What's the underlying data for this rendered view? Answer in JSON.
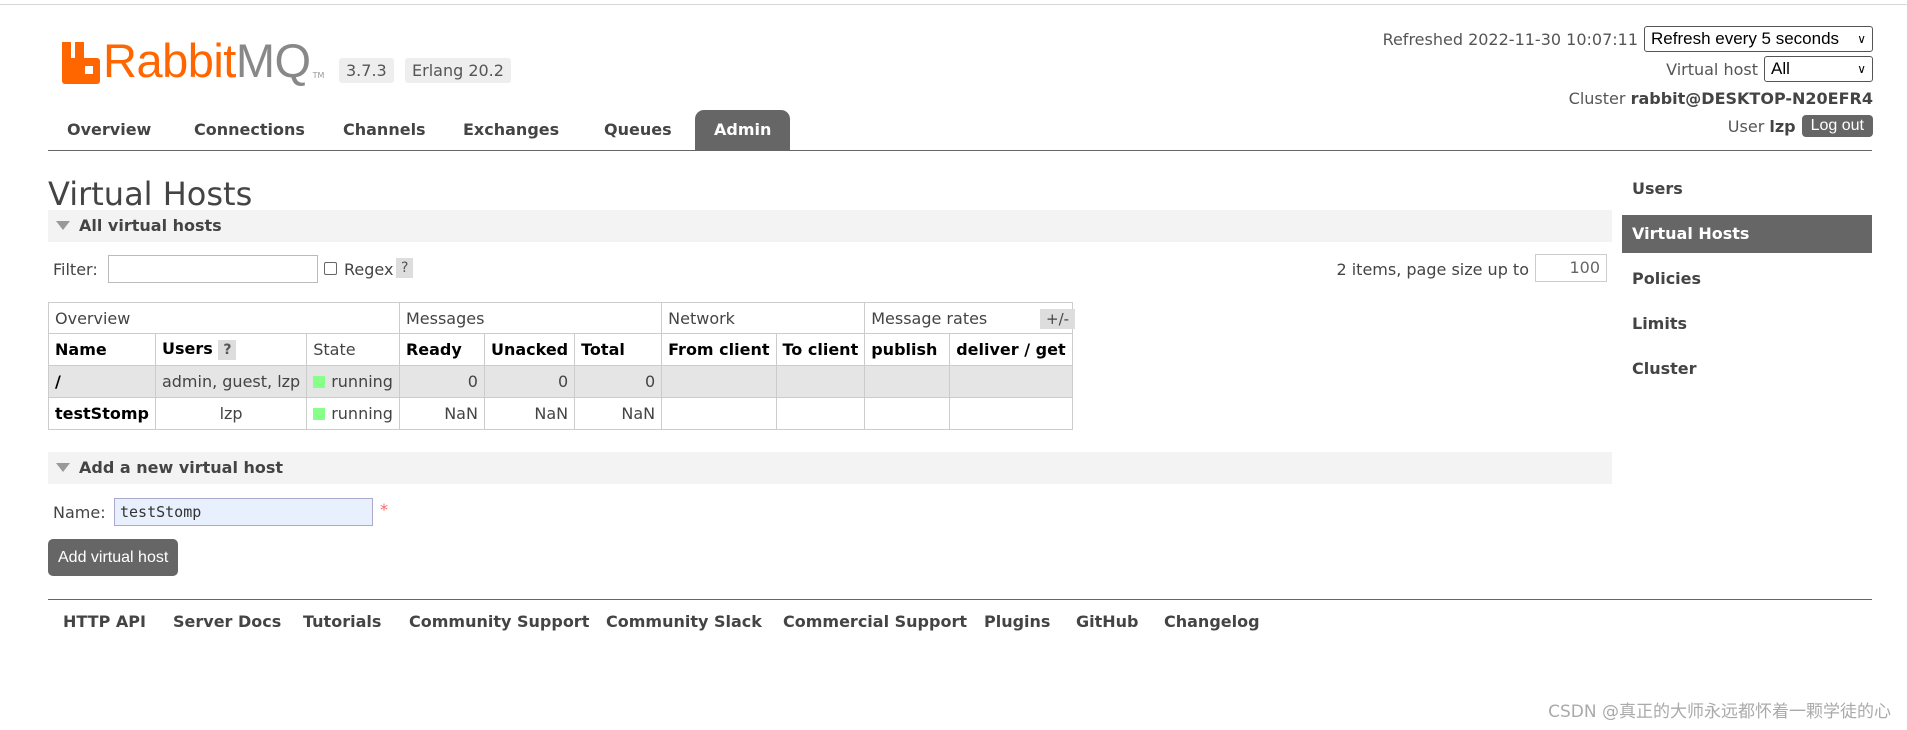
{
  "app": {
    "brand_rabbit": "Rabbit",
    "brand_mq": "MQ",
    "tm": "TM",
    "version": "3.7.3",
    "erlang": "Erlang 20.2"
  },
  "header": {
    "refreshed_label": "Refreshed 2022-11-30 10:07:11",
    "refresh_select": "Refresh every 5 seconds",
    "vhost_label": "Virtual host",
    "vhost_select": "All",
    "cluster_label": "Cluster",
    "cluster_value": "rabbit@DESKTOP-N20EFR4",
    "user_label": "User",
    "user_value": "lzp",
    "logout": "Log out"
  },
  "nav": [
    "Overview",
    "Connections",
    "Channels",
    "Exchanges",
    "Queues",
    "Admin"
  ],
  "page": {
    "title": "Virtual Hosts",
    "section_all": "All virtual hosts",
    "filter_label": "Filter:",
    "regex_label": "Regex",
    "help": "?",
    "items_label": "2 items, page size up to",
    "page_size": "100",
    "toggle_columns": "+/-"
  },
  "table": {
    "groups": [
      "Overview",
      "Messages",
      "Network",
      "Message rates"
    ],
    "columns": [
      "Name",
      "Users",
      "State",
      "Ready",
      "Unacked",
      "Total",
      "From client",
      "To client",
      "publish",
      "deliver / get"
    ],
    "rows": [
      {
        "name": "/",
        "users": "admin, guest, lzp",
        "state": "running",
        "ready": "0",
        "unacked": "0",
        "total": "0"
      },
      {
        "name": "testStomp",
        "users": "lzp",
        "state": "running",
        "ready": "NaN",
        "unacked": "NaN",
        "total": "NaN"
      }
    ]
  },
  "add_form": {
    "section": "Add a new virtual host",
    "name_label": "Name:",
    "name_value": "testStomp",
    "required": "*",
    "button": "Add virtual host"
  },
  "footer": [
    "HTTP API",
    "Server Docs",
    "Tutorials",
    "Community Support",
    "Community Slack",
    "Commercial Support",
    "Plugins",
    "GitHub",
    "Changelog"
  ],
  "sidebar": [
    "Users",
    "Virtual Hosts",
    "Policies",
    "Limits",
    "Cluster"
  ],
  "watermark": "CSDN @真正的大师永远都怀着一颗学徒的心",
  "colors": {
    "brand_orange": "#ff6600",
    "tab_active": "#666666",
    "running": "#88ff88"
  }
}
